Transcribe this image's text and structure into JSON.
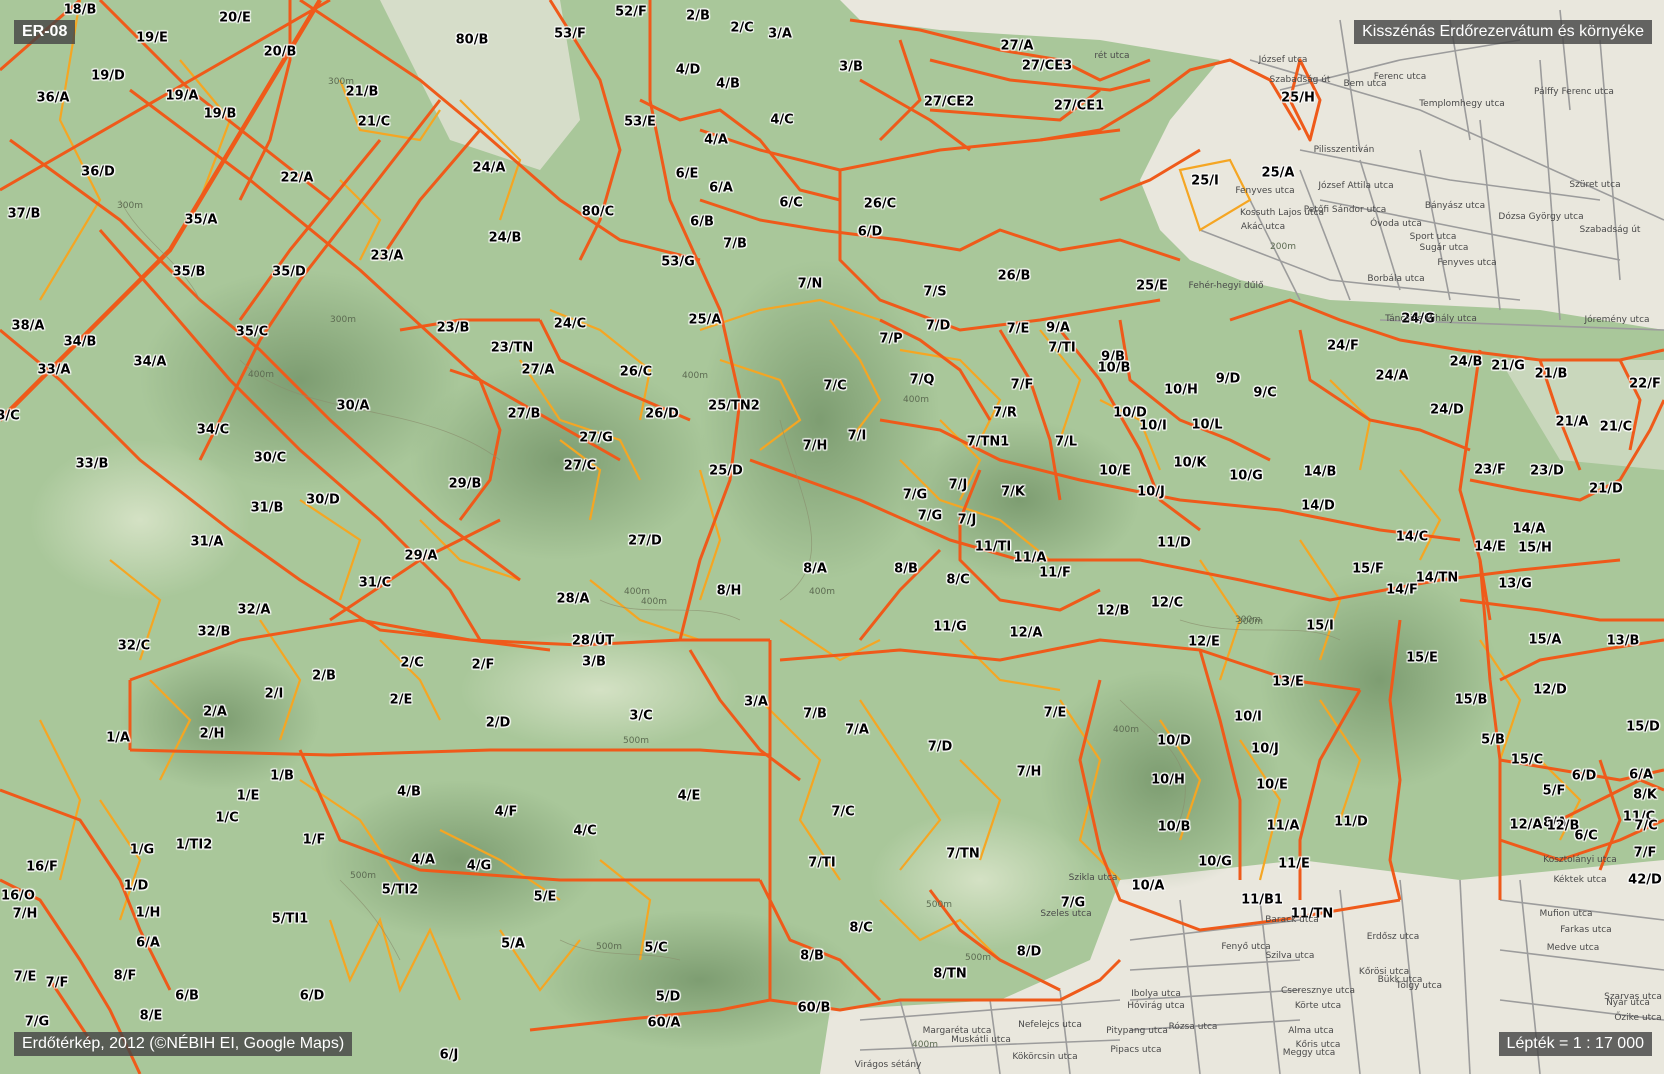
{
  "header": {
    "map_code": "ER-08",
    "title": "Kisszénás Erdőrezervátum és környéke"
  },
  "footer": {
    "credit": "Erdőtérkép, 2012 (©NÉBIH EI, Google Maps)",
    "scale": "Lépték = 1 : 17 000"
  },
  "colors": {
    "forest": "#a9c79a",
    "town": "#e9e7dd",
    "major_boundary": "#ef5a1a",
    "minor_boundary": "#f5a623"
  },
  "compartments": [
    "18/B",
    "20/E",
    "19/E",
    "20/B",
    "19/D",
    "36/A",
    "19/A",
    "19/B",
    "80/B",
    "53/F",
    "52/F",
    "2/B",
    "2/C",
    "3/A",
    "3/B",
    "27/A",
    "27/CE3",
    "27/CE2",
    "27/CE1",
    "21/B",
    "21/C",
    "36/D",
    "37/B",
    "22/A",
    "35/A",
    "24/A",
    "80/C",
    "23/A",
    "24/B",
    "35/B",
    "35/D",
    "38/A",
    "34/B",
    "35/C",
    "23/B",
    "24/C",
    "33/A",
    "34/A",
    "23/TN",
    "27/A",
    "3/C",
    "30/A",
    "27/B",
    "34/C",
    "27/G",
    "30/C",
    "27/C",
    "33/B",
    "29/B",
    "30/D",
    "31/B",
    "31/A",
    "29/A",
    "27/D",
    "31/C",
    "4/B",
    "32/A",
    "28/A",
    "32/B",
    "5/A",
    "32/C",
    "2/B",
    "2/C",
    "2/F",
    "28/ÚT",
    "3/B",
    "2/I",
    "2/E",
    "2/A",
    "2/H",
    "2/D",
    "3/C",
    "3/A",
    "1/A",
    "1/B",
    "1/E",
    "1/C",
    "4/B",
    "4/F",
    "4/E",
    "1/G",
    "1/TI2",
    "1/F",
    "4/C",
    "16/F",
    "1/D",
    "4/A",
    "4/G",
    "5/TI2",
    "5/E",
    "16/O",
    "7/H",
    "1/H",
    "5/TI1",
    "6/A",
    "5/A",
    "5/C",
    "7/E",
    "7/F",
    "8/F",
    "7/G",
    "8/E",
    "6/B",
    "6/D",
    "5/D",
    "60/A",
    "6/J",
    "4/D",
    "4/B",
    "53/E",
    "4/C",
    "4/A",
    "6/E",
    "6/A",
    "6/C",
    "26/C",
    "6/B",
    "7/B",
    "6/D",
    "53/G",
    "7/N",
    "7/S",
    "26/B",
    "25/A",
    "7/D",
    "7/P",
    "7/E",
    "9/A",
    "7/TI",
    "9/B",
    "10/B",
    "26/C",
    "26/D",
    "25/TN2",
    "7/C",
    "7/Q",
    "7/F",
    "9/D",
    "10/H",
    "9/C",
    "10/D",
    "7/R",
    "10/I",
    "10/L",
    "7/I",
    "7/H",
    "7/TN1",
    "7/L",
    "10/E",
    "10/K",
    "25/D",
    "10/G",
    "7/J",
    "10/J",
    "7/G",
    "7/K",
    "7/G",
    "7/J",
    "11/TI",
    "11/A",
    "11/F",
    "11/D",
    "8/A",
    "8/B",
    "8/C",
    "8/H",
    "12/B",
    "12/C",
    "11/G",
    "12/A",
    "12/E",
    "7/B",
    "7/A",
    "7/E",
    "10/I",
    "10/D",
    "7/D",
    "10/J",
    "7/H",
    "10/H",
    "10/E",
    "7/C",
    "11/A",
    "11/D",
    "10/B",
    "7/TI",
    "7/TN",
    "10/G",
    "11/E",
    "10/A",
    "11/B1",
    "11/TN",
    "7/G",
    "8/C",
    "8/B",
    "8/D",
    "8/TN",
    "60/B",
    "25/H",
    "25/I",
    "25/A",
    "25/E",
    "24/G",
    "24/F",
    "24/A",
    "24/B",
    "21/G",
    "21/B",
    "24/D",
    "21/A",
    "21/C",
    "22/F",
    "23/F",
    "23/D",
    "21/D",
    "14/B",
    "14/D",
    "14/A",
    "14/C",
    "15/H",
    "14/E",
    "15/F",
    "14/TN",
    "14/F",
    "13/G",
    "15/I",
    "13/B",
    "15/A",
    "15/E",
    "13/E",
    "12/D",
    "15/B",
    "15/D",
    "5/B",
    "15/C",
    "6/D",
    "6/A",
    "5/F",
    "8/K",
    "8/A",
    "11/C",
    "12/A",
    "12/B",
    "6/C",
    "7/F",
    "42/D",
    "7/C",
    "7/A"
  ],
  "streets": [
    "rét utca",
    "József utca",
    "Ferenc utca",
    "Bem utca",
    "Szabadság út",
    "Templomhegy utca",
    "Pálffy Ferenc utca",
    "Pilisszentiván",
    "József Attila utca",
    "Fenyves utca",
    "Kossuth Lajos utca",
    "Petőfi Sándor utca",
    "Óvoda utca",
    "Bányász utca",
    "Dózsa György utca",
    "Szabadság út",
    "Sport utca",
    "Szüret utca",
    "Sugár utca",
    "Fenyves utca",
    "Borbála utca",
    "Fehér-hegyi dűlő",
    "Táncsics Mihály utca",
    "Jóremény utca",
    "Barack utca",
    "Szilva utca",
    "Cseresznye utca",
    "Körte utca",
    "Alma utca",
    "Meggy utca",
    "Ibolya utca",
    "Hóvirág utca",
    "Nefelejcs utca",
    "Margaréta utca",
    "Virágos sétány",
    "Muskátli utca",
    "Kökörcsin utca",
    "Pitypang utca",
    "Pipacs utca",
    "Rózsa utca",
    "Fenyő utca",
    "Kőris utca",
    "Szikla utca",
    "Akác utca",
    "Nyár utca",
    "Szarvas utca",
    "Őzike utca",
    "Farkas utca",
    "Medve utca",
    "Mufion utca",
    "Erdősz utca",
    "Tölgy utca",
    "Bükk utca",
    "Kőrösi utca",
    "Szeles utca",
    "Kéktek utca",
    "Kosztolányi utca"
  ],
  "contours": [
    "300m",
    "300m",
    "300m",
    "300m",
    "400m",
    "400m",
    "400m",
    "400m",
    "400m",
    "400m",
    "400m",
    "500m",
    "500m",
    "500m",
    "500m",
    "500m",
    "400m",
    "300m",
    "200m"
  ]
}
